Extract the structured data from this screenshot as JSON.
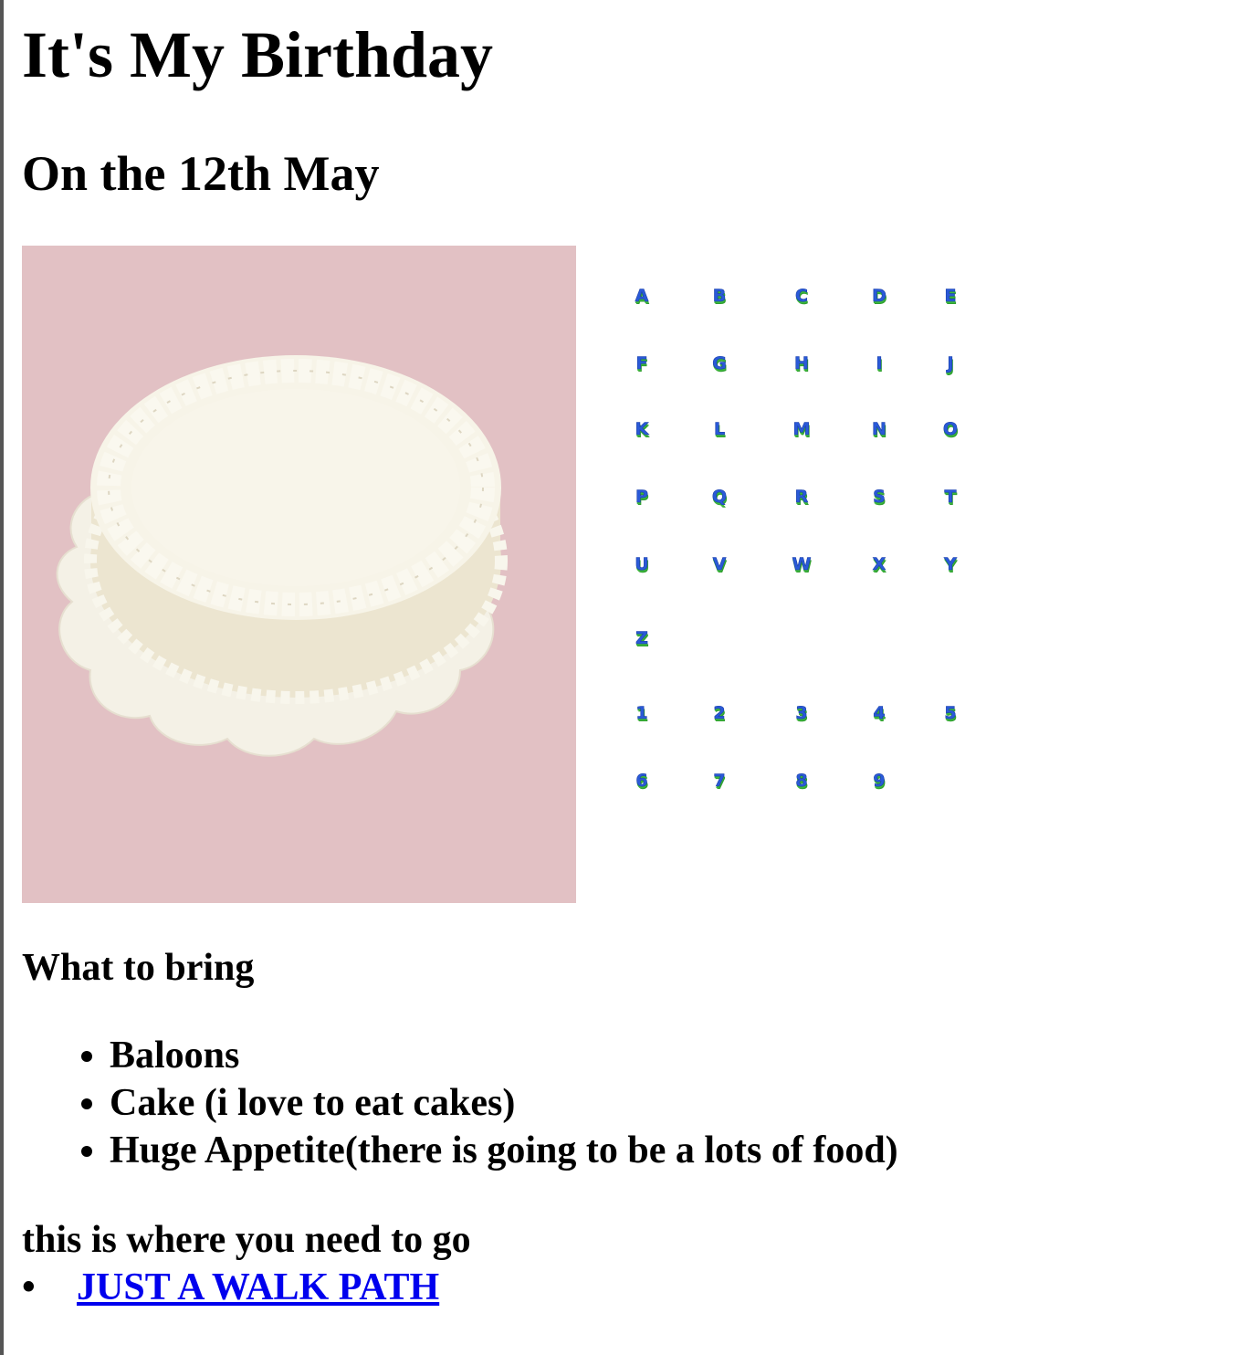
{
  "page": {
    "title": "It's My Birthday",
    "subtitle": "On the 12th May"
  },
  "images": {
    "cake": {
      "icon": "cake-image",
      "background_color": "#e2c1c4",
      "frosting_color": "#f7f4e8"
    },
    "alphabet": {
      "icon": "alphabet-numbers-image",
      "glyphs": [
        "A",
        "B",
        "C",
        "D",
        "E",
        "F",
        "G",
        "H",
        "I",
        "J",
        "K",
        "L",
        "M",
        "N",
        "O",
        "P",
        "Q",
        "R",
        "S",
        "T",
        "U",
        "V",
        "W",
        "X",
        "Y",
        "Z",
        "1",
        "2",
        "3",
        "4",
        "5",
        "6",
        "7",
        "8",
        "9"
      ],
      "fill_color": "#2a5ad8",
      "shadow_color": "#3cb83c"
    }
  },
  "bring": {
    "heading": "What to bring",
    "items": [
      "Baloons",
      "Cake (i love to eat cakes)",
      "Huge Appetite(there is going to be a lots of food)"
    ]
  },
  "directions": {
    "heading": "this is where you need to go",
    "link_label": "JUST A WALK PATH",
    "link_color": "#0000ee"
  }
}
